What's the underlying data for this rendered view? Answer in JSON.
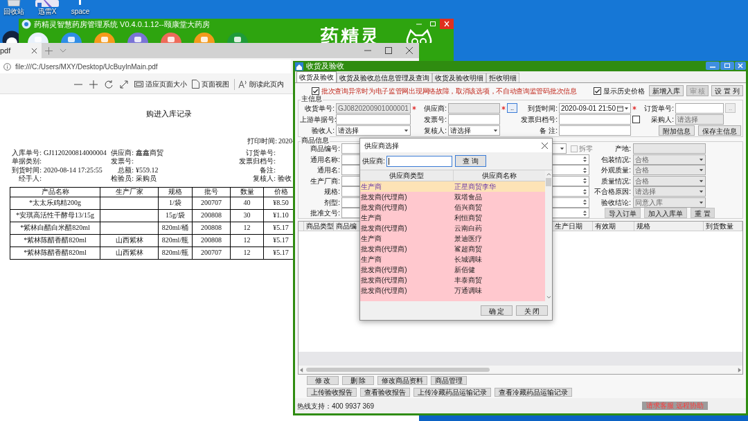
{
  "desktop_icons": [
    {
      "label": "回收站"
    },
    {
      "label": "迅雷X"
    },
    {
      "label": "space"
    }
  ],
  "back_window": {
    "title": "药精灵智慧药房管理系统 V0.4.0.1.12--颐康堂大药房",
    "logo": "药精灵"
  },
  "browser": {
    "tab": "pdf",
    "address": "file:///C:/Users/MXY/Desktop/UcBuyInMain.pdf",
    "tools": [
      {
        "kind": "fit",
        "label": "适应页面大小"
      },
      {
        "kind": "view",
        "label": "页面视图"
      },
      {
        "kind": "read",
        "label": "朗读此页内"
      }
    ]
  },
  "document": {
    "title": "购进入库记录",
    "print_time": {
      "label": "打印时间:",
      "value": "2020-"
    },
    "info": [
      [
        {
          "label": "入库单号:",
          "value": "GJ1120200814000004"
        },
        {
          "label": "单据类别:"
        },
        {
          "label": "到货时间:",
          "value": "2020-08-14 17:25:55"
        },
        {
          "label": "经手人:"
        }
      ],
      [
        {
          "label": "供应商:",
          "value": "鑫鑫商贸"
        },
        {
          "label": "发票号:"
        },
        {
          "label": "总额:",
          "value": "¥559.12"
        },
        {
          "label": "检验员:",
          "value": "采购员"
        }
      ],
      [
        {
          "label": "订货单号:"
        },
        {
          "label": "发票归档号:"
        },
        {
          "label": "备注:"
        },
        {
          "label": "复核人:",
          "value": "验收"
        }
      ]
    ],
    "table": {
      "columns": [
        "产品名称",
        "生产厂家",
        "规格",
        "批号",
        "数量",
        "价格"
      ],
      "rows": [
        [
          "*太太乐鸡精200g",
          null,
          "1/袋",
          "200707",
          "40",
          "¥8.50"
        ],
        [
          "*安琪高活性干酵母13/15g",
          null,
          "15g/袋",
          "200808",
          "30",
          "¥1.10"
        ],
        [
          "*紫林白醋白米醋820ml",
          null,
          "820ml/桶",
          "200808",
          "12",
          "¥5.17"
        ],
        [
          "*紫林陈醋香醋820ml",
          "山西紫林",
          "820ml/瓶",
          "200808",
          "12",
          "¥5.17"
        ],
        [
          "*紫林陈醋香醋820ml",
          "山西紫林",
          "820ml/瓶",
          "200707",
          "12",
          "¥5.17"
        ]
      ]
    }
  },
  "app": {
    "title": "收货及验收",
    "tabs": [
      {
        "label": "收货及验收",
        "selected": true
      },
      {
        "label": "收货及验收总信息管理及查询",
        "selected": false
      },
      {
        "label": "收货及验收明细",
        "selected": false
      },
      {
        "label": "拒收明细",
        "selected": false
      }
    ],
    "notice": {
      "checked": true,
      "text": "批次查询异常时为电子监管网出现网络故障，取消该选项，不自动查询监管码批次信息"
    },
    "history": {
      "checked": true,
      "label": "显示历史价格"
    },
    "top_buttons": [
      {
        "label": "新增入库",
        "disabled": false
      },
      {
        "label": "审 核",
        "disabled": true
      },
      {
        "label": "设 置 列",
        "disabled": false
      }
    ],
    "main_info": {
      "title": "主信息",
      "rows": [
        [
          {
            "label": "收货单号:",
            "kind": "text",
            "value": "GJ0820200901000001",
            "disabled": true,
            "required": true
          },
          {
            "label": "供应商:",
            "kind": "lookup",
            "disabled": true,
            "required": true,
            "button": {
              "label": "..",
              "disabled": false
            }
          },
          {
            "label": "到货时间:",
            "kind": "date",
            "value": "2020-09-01 21:50",
            "disabled": false,
            "required": true
          },
          {
            "label": "订货单号:",
            "kind": "lookup",
            "disabled": false,
            "required": false,
            "button": {
              "label": "..",
              "disabled": true
            }
          }
        ],
        [
          {
            "label": "上游单据号:",
            "kind": "text",
            "disabled": false,
            "required": false
          },
          {
            "label": "发票号:",
            "kind": "text",
            "disabled": false,
            "required": false
          },
          {
            "label": "发票归档号:",
            "kind": "text",
            "disabled": false,
            "required": false,
            "checkbox": {
              "checked": false
            }
          },
          {
            "label": "采购人:",
            "kind": "text",
            "value": "请选择",
            "disabled": true,
            "required": false
          }
        ],
        [
          {
            "label": "验收人:",
            "kind": "select",
            "value": "请选择",
            "disabled": false,
            "required": false
          },
          {
            "label": "复核人:",
            "kind": "select",
            "value": "请选择",
            "disabled": false,
            "required": false
          },
          {
            "label": "备 注:",
            "kind": "text",
            "disabled": false,
            "required": false
          }
        ]
      ],
      "buttons": [
        "附加信息",
        "保存主信息"
      ]
    },
    "goods": {
      "title": "商品信息",
      "left": [
        {
          "label": "商品编号:",
          "kind": "select"
        },
        {
          "label": "通用名称:",
          "kind": "spin"
        },
        {
          "label": "通用名:",
          "kind": "spin"
        },
        {
          "label": "生产厂商:",
          "kind": "spin"
        },
        {
          "label": "规格:",
          "kind": "spin"
        },
        {
          "label": "剂型:",
          "kind": "spin"
        },
        {
          "label": "批准文号:",
          "kind": "spin"
        }
      ],
      "split": {
        "label": "拆零",
        "checked": false
      },
      "right": [
        {
          "label": "产地:",
          "kind": "text"
        },
        {
          "label": "包装情况:",
          "kind": "select",
          "value": "合格"
        },
        {
          "label": "外观质量:",
          "kind": "select",
          "value": "合格"
        },
        {
          "label": "质量情况:",
          "kind": "select",
          "value": "合格"
        },
        {
          "label": "不合格原因:",
          "kind": "select",
          "value": "请选择"
        },
        {
          "label": "验收结论:",
          "kind": "select",
          "value": "同意入库"
        }
      ],
      "buttons": [
        "导入订单",
        "加入入库单",
        "重 置"
      ]
    },
    "grid": {
      "columns": [
        "商品类型",
        "商品编",
        "生产日期",
        "有效期",
        "规格",
        "到货数量"
      ]
    },
    "bottom_buttons": [
      [
        "修 改",
        "删 除",
        "修改商品资料",
        "商品管理"
      ],
      [
        "上传验收报告",
        "查看验收报告",
        "上传冷藏药品运输记录",
        "查看冷藏药品运输记录"
      ]
    ],
    "status": {
      "hotline": "热线支持：400 9937 369",
      "remote": "请求客服 远程协助"
    }
  },
  "dialog": {
    "title": "供应商选择",
    "search_label": "供应商:",
    "search_button": "查 询",
    "columns": [
      "供应商类型",
      "供应商名称"
    ],
    "rows": [
      {
        "type": "生产商",
        "name": "正星商贸李华",
        "selected": true
      },
      {
        "type": "批发商(代理商)",
        "name": "双塔食品",
        "selected": false
      },
      {
        "type": "批发商(代理商)",
        "name": "佰兴商贸",
        "selected": false
      },
      {
        "type": "生产商",
        "name": "利恒商贸",
        "selected": false
      },
      {
        "type": "批发商(代理商)",
        "name": "云南白药",
        "selected": false
      },
      {
        "type": "生产商",
        "name": "景迪医疗",
        "selected": false
      },
      {
        "type": "批发商(代理商)",
        "name": "鲨超商贸",
        "selected": false
      },
      {
        "type": "生产商",
        "name": "长城调味",
        "selected": false
      },
      {
        "type": "批发商(代理商)",
        "name": "新佰健",
        "selected": false
      },
      {
        "type": "批发商(代理商)",
        "name": "丰泰商贸",
        "selected": false
      },
      {
        "type": "批发商(代理商)",
        "name": "万通调味",
        "selected": false
      }
    ],
    "buttons": [
      "确 定",
      "关 闭"
    ]
  }
}
